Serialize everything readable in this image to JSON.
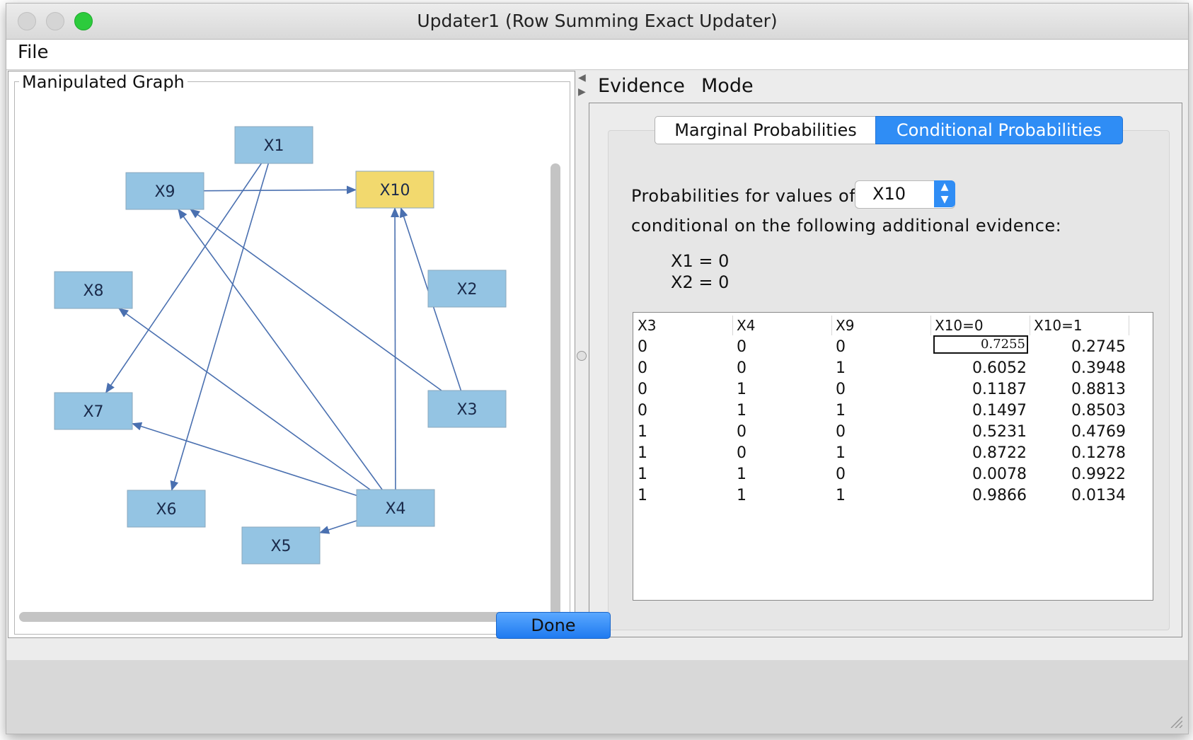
{
  "window": {
    "title": "Updater1 (Row Summing Exact Updater)"
  },
  "menubar": {
    "file": "File"
  },
  "graph": {
    "group_label": "Manipulated Graph",
    "nodes": [
      {
        "id": "X1",
        "label": "X1",
        "selected": false
      },
      {
        "id": "X9",
        "label": "X9",
        "selected": false
      },
      {
        "id": "X10",
        "label": "X10",
        "selected": true
      },
      {
        "id": "X8",
        "label": "X8",
        "selected": false
      },
      {
        "id": "X2",
        "label": "X2",
        "selected": false
      },
      {
        "id": "X7",
        "label": "X7",
        "selected": false
      },
      {
        "id": "X3",
        "label": "X3",
        "selected": false
      },
      {
        "id": "X6",
        "label": "X6",
        "selected": false
      },
      {
        "id": "X4",
        "label": "X4",
        "selected": false
      },
      {
        "id": "X5",
        "label": "X5",
        "selected": false
      }
    ],
    "edges": [
      [
        "X9",
        "X10"
      ],
      [
        "X1",
        "X7"
      ],
      [
        "X1",
        "X6"
      ],
      [
        "X3",
        "X9"
      ],
      [
        "X3",
        "X10"
      ],
      [
        "X4",
        "X9"
      ],
      [
        "X4",
        "X10"
      ],
      [
        "X4",
        "X8"
      ],
      [
        "X4",
        "X7"
      ],
      [
        "X4",
        "X5"
      ]
    ],
    "colors": {
      "node": "#94c4e3",
      "selected_node": "#f2d96e",
      "edge": "#4a70b0"
    }
  },
  "right_menu": {
    "evidence": "Evidence",
    "mode": "Mode"
  },
  "tabs": {
    "marginal": "Marginal Probabilities",
    "conditional": "Conditional Probabilities",
    "active": "conditional"
  },
  "conditional": {
    "probs_label": "Probabilities for values of",
    "selected_variable": "X10",
    "cond_label": "conditional on the following additional evidence:",
    "evidence": [
      "X1 = 0",
      "X2 = 0"
    ]
  },
  "table": {
    "headers": [
      "X3",
      "X4",
      "X9",
      "X10=0",
      "X10=1"
    ],
    "rows": [
      [
        "0",
        "0",
        "0",
        "0.7255",
        "0.2745"
      ],
      [
        "0",
        "0",
        "1",
        "0.6052",
        "0.3948"
      ],
      [
        "0",
        "1",
        "0",
        "0.1187",
        "0.8813"
      ],
      [
        "0",
        "1",
        "1",
        "0.1497",
        "0.8503"
      ],
      [
        "1",
        "0",
        "0",
        "0.5231",
        "0.4769"
      ],
      [
        "1",
        "0",
        "1",
        "0.8722",
        "0.1278"
      ],
      [
        "1",
        "1",
        "0",
        "0.0078",
        "0.9922"
      ],
      [
        "1",
        "1",
        "1",
        "0.9866",
        "0.0134"
      ]
    ]
  },
  "buttons": {
    "done": "Done"
  },
  "accent": "#2f8df5"
}
